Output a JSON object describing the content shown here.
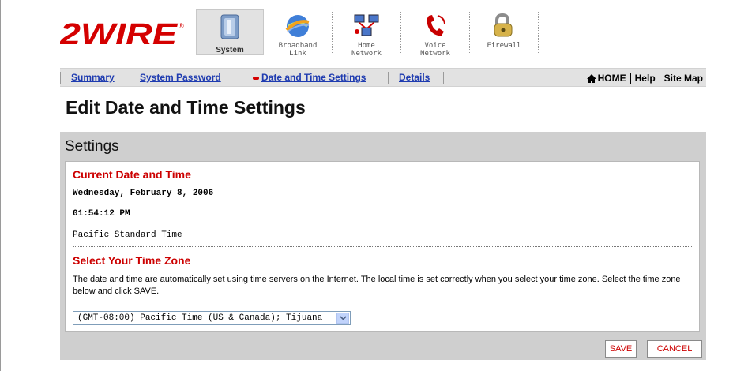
{
  "brand": {
    "logo_text": "2WIRE",
    "registered": "®",
    "accent": "#d40000"
  },
  "tabs": [
    {
      "label": "System",
      "icon": "system-panel-icon",
      "active": true
    },
    {
      "label": "Broadband\nLink",
      "icon": "globe-icon",
      "active": false
    },
    {
      "label": "Home\nNetwork",
      "icon": "network-computers-icon",
      "active": false
    },
    {
      "label": "Voice\nNetwork",
      "icon": "phone-icon",
      "active": false
    },
    {
      "label": "Firewall",
      "icon": "padlock-icon",
      "active": false
    }
  ],
  "subnav": {
    "items": [
      {
        "label": "Summary"
      },
      {
        "label": "System Password"
      },
      {
        "label": "Date and Time Settings",
        "current": true
      },
      {
        "label": "Details"
      }
    ],
    "right": {
      "home": "HOME",
      "help": "Help",
      "sitemap": "Site Map"
    }
  },
  "page_title": "Edit Date and Time Settings",
  "settings": {
    "title": "Settings",
    "current_heading": "Current Date and Time",
    "date": "Wednesday, February 8, 2006",
    "time": "01:54:12 PM",
    "zone_name": "Pacific Standard Time",
    "select_heading": "Select Your Time Zone",
    "description": "The date and time are automatically set using time servers on the Internet. The local time is set correctly when you select your time zone. Select the time zone below and click SAVE.",
    "timezone_selected": "(GMT-08:00) Pacific Time (US & Canada); Tijuana",
    "save_label": "SAVE",
    "cancel_label": "CANCEL"
  }
}
